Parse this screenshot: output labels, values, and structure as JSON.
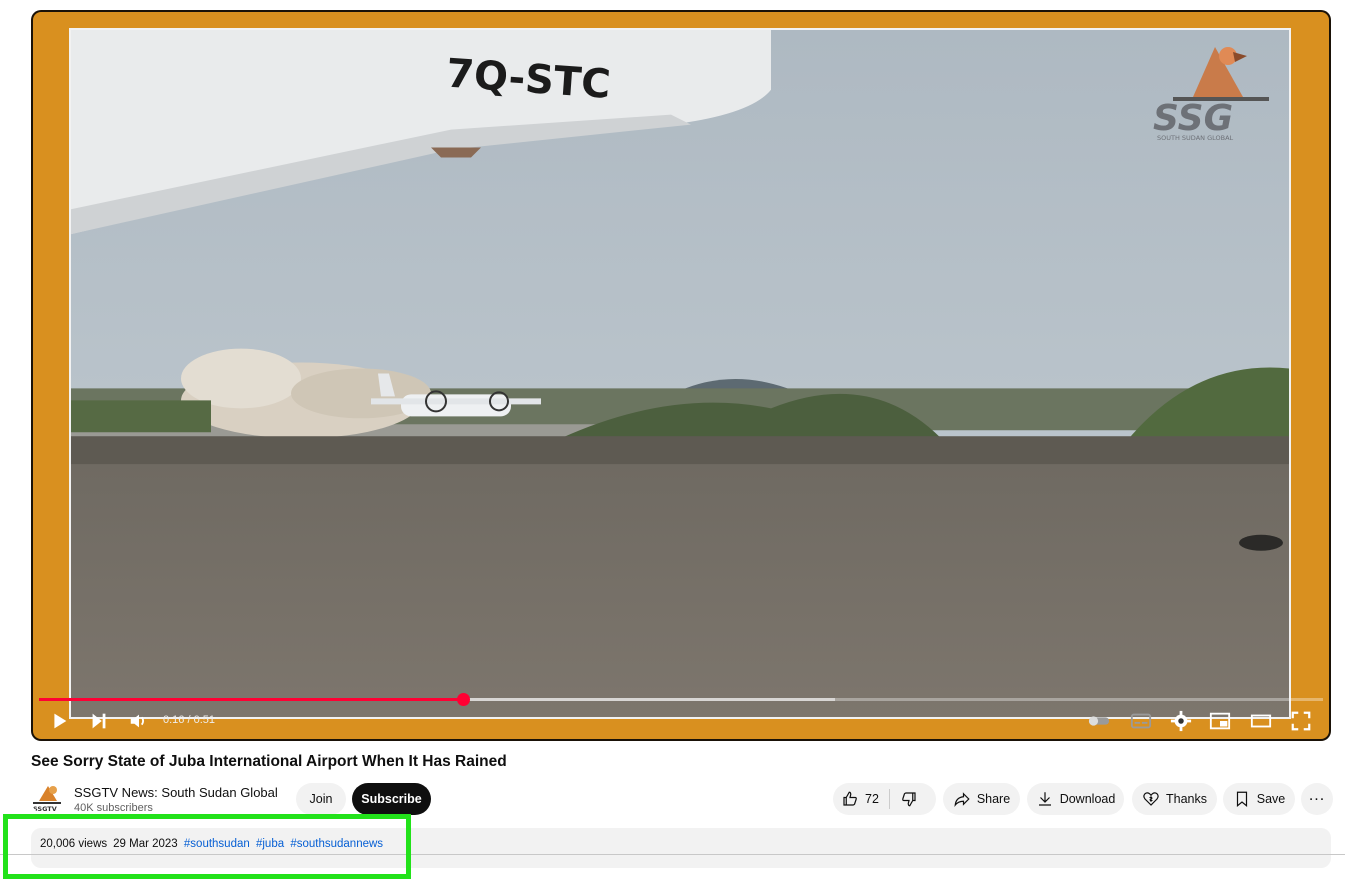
{
  "video": {
    "aircraft_registration": "7Q-STC",
    "watermark_text": "SSG",
    "watermark_subtext": "SOUTH SUDAN GLOBAL",
    "time_display": "0:16 / 0:51",
    "progress_played_fraction": 0.33,
    "progress_buffered_fraction": 0.62,
    "controls": {
      "play": "play-icon",
      "next": "next-icon",
      "volume": "volume-icon",
      "autoplay": "autoplay-toggle-icon",
      "captions": "subtitles-icon",
      "settings": "gear-icon",
      "miniplayer": "miniplayer-icon",
      "theater": "theater-icon",
      "fullscreen": "fullscreen-icon"
    }
  },
  "title": "See Sorry State of Juba International Airport When It Has Rained",
  "channel": {
    "avatar_label": "SSGTV",
    "name": "SSGTV News: South Sudan Global",
    "subscribers": "40K subscribers",
    "join_label": "Join",
    "subscribe_label": "Subscribe"
  },
  "actions": {
    "likes": "72",
    "share_label": "Share",
    "download_label": "Download",
    "thanks_label": "Thanks",
    "save_label": "Save",
    "more_label": "..."
  },
  "description": {
    "views": "20,006 views",
    "date": "29 Mar 2023",
    "hashtags": [
      "#southsudan",
      "#juba",
      "#southsudannews"
    ]
  },
  "colors": {
    "frame_orange": "#d9901f",
    "progress_red": "#ff0033",
    "link_blue": "#065fd4",
    "highlight_green": "#22e21a"
  }
}
